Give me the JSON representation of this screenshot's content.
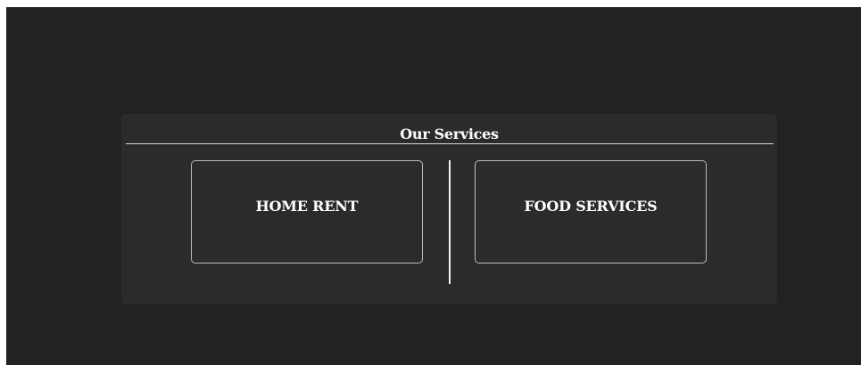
{
  "services": {
    "title": "Our Services",
    "items": [
      {
        "label": "HOME RENT"
      },
      {
        "label": "FOOD SERVICES"
      }
    ]
  },
  "colors": {
    "page_background": "#222222",
    "panel_background": "#2b2b2b",
    "text": "#ffffff",
    "card_border": "#bdbdbd"
  }
}
